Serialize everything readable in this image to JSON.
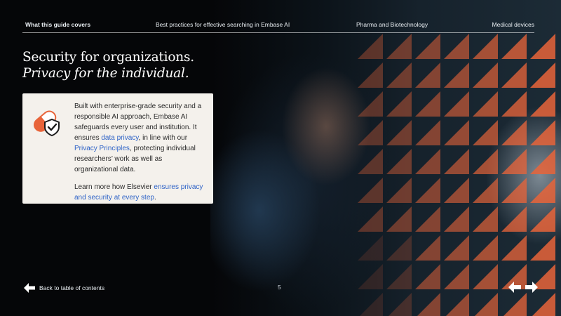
{
  "nav": {
    "items": [
      "What this guide covers",
      "Best practices for effective searching in Embase AI",
      "Pharma and Biotechnology",
      "Medical devices"
    ]
  },
  "headline": {
    "line1": "Security for organizations.",
    "line2": "Privacy for the individual."
  },
  "card": {
    "p1_a": "Built with enterprise-grade security and a responsible AI approach, Embase AI safeguards every user and institution. It ensures ",
    "p1_link1": "data privacy",
    "p1_b": ", in line with our ",
    "p1_link2": "Privacy Principles",
    "p1_c": ", protecting individual researchers’ work as well as organizational data.",
    "p2_a": "Learn more how Elsevier ",
    "p2_link": "ensures privacy and security at every step",
    "p2_b": "."
  },
  "footer": {
    "back_label": "Back to table of contents",
    "page_number": "5"
  },
  "colors": {
    "accent_orange": "#e8643a",
    "link_blue": "#2e63c7",
    "card_bg": "#f4f1ec"
  },
  "icons": {
    "card_icon": "pill-shield-check-icon",
    "back_icon": "arrow-left-icon",
    "prev_icon": "arrow-left-icon",
    "next_icon": "arrow-right-icon"
  }
}
